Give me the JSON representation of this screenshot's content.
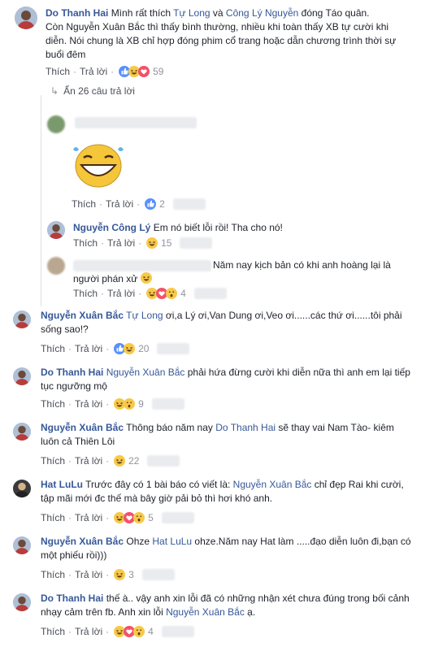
{
  "common": {
    "like": "Thích",
    "reply": "Trả lời",
    "dot": "·"
  },
  "replies_toggle": "Ẩn 26 câu trả lời",
  "comments": [
    {
      "name": "Do Thanh Hai",
      "parts": [
        {
          "t": "Mình rất thích "
        },
        {
          "t": "Tự Long",
          "link": true
        },
        {
          "t": " và "
        },
        {
          "t": "Công Lý Nguyễn",
          "link": true
        },
        {
          "t": " đóng Táo quân."
        }
      ],
      "lines2": "Còn Nguyễn Xuân Bắc thì thấy bình thường, nhiều khi toàn thấy XB tự cười khi diễn. Nói chung là XB chỉ hợp đóng phim cổ trang hoặc dẫn chương trình thời sự buổi đêm",
      "count": "59"
    },
    {
      "name": "",
      "count": "2"
    },
    {
      "name": "Nguyễn Công Lý",
      "text": "Em nó biết lỗi rồi! Tha cho nó!",
      "count": "15"
    },
    {
      "name": "",
      "text": "Năm nay kịch bản có khi anh hoàng lại là người phán xử",
      "count": "4"
    },
    {
      "name": "Nguyễn Xuân Bắc",
      "link": "Tự Long",
      "text": " ơi,a Lý ơi,Van Dung ơi,Veo ơi......các thứ ơi......tôi phải sống sao!?",
      "count": "20"
    },
    {
      "name": "Do Thanh Hai",
      "link": "Nguyễn Xuân Bắc",
      "text": " phải hứa đừng cười khi diễn nữa thì anh em lại tiếp tục ngưỡng mộ",
      "count": "9"
    },
    {
      "name": "Nguyễn Xuân Bắc",
      "text_pre": "Thông báo năm nay ",
      "link": "Do Thanh Hai",
      "text": " sẽ thay vai Nam Tào- kiêm luôn cả Thiên Lôi",
      "count": "22"
    },
    {
      "name": "Hat LuLu",
      "text_pre": "Trước đây có 1 bài báo có viết là: ",
      "link": "Nguyễn Xuân Bắc",
      "text": " chỉ đẹp Rai khi cười, tập mãi mới đc thế mà bây giờ pải bỏ thì hơi khó anh.",
      "count": "5"
    },
    {
      "name": "Nguyễn Xuân Bắc",
      "text_pre": "Ohze ",
      "link": "Hat LuLu",
      "text": " ohze.Năm nay Hat làm .....đạo diễn luôn đi,bạn có một phiếu rồi)))",
      "count": "3"
    },
    {
      "name": "Do Thanh Hai",
      "text_pre": "thế à.. vậy anh xin lỗi đã có những nhận xét chưa đúng trong bối cảnh nhạy cảm trên fb. Anh xin lỗi ",
      "link": "Nguyễn Xuân Bắc",
      "text": " ạ.",
      "count": "4"
    }
  ]
}
